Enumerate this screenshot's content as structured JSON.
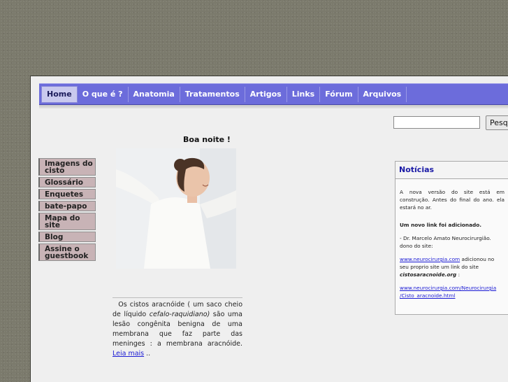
{
  "nav": {
    "items": [
      "Home",
      "O que é ?",
      "Anatomia",
      "Tratamentos",
      "Artigos",
      "Links",
      "Fórum",
      "Arquivos"
    ]
  },
  "search": {
    "button_label": "Pesquisar",
    "value": ""
  },
  "greeting": "Boa noite !",
  "sidebar": {
    "items": [
      "Imagens do cisto",
      "Glossário",
      "Enquetes",
      "bate-papo",
      "Mapa do site",
      "Blog",
      "Assine o guestbook"
    ]
  },
  "article": {
    "text_1": "Os cistos aracnóide ( um saco cheio de líquido ",
    "text_italic": "cefalo-raquidiano)",
    "text_2": " são uma lesão congênita benigna de uma membrana que faz parte das meninges : a membrana aracnóide. ",
    "read_more": "Leia mais",
    "tail": " .."
  },
  "news": {
    "title": "Notícias",
    "p1": "A nova versão do site está em construção. Antes do final do ano. ela estará no ar.",
    "p2": "Um novo link foi adicionado.",
    "p3": "- Dr. Marcelo Amato Neurocirurgião. dono do site:",
    "link1": "www.neurocirurgia.com",
    "p4_rest": " adicionou no seu proprio site um link do site",
    "site_name": "cistosaracnoide.org",
    "colon": " :",
    "link2": "www.neurocirurgia.com/Neurocirurgia /Cisto_aracnoide.html"
  }
}
